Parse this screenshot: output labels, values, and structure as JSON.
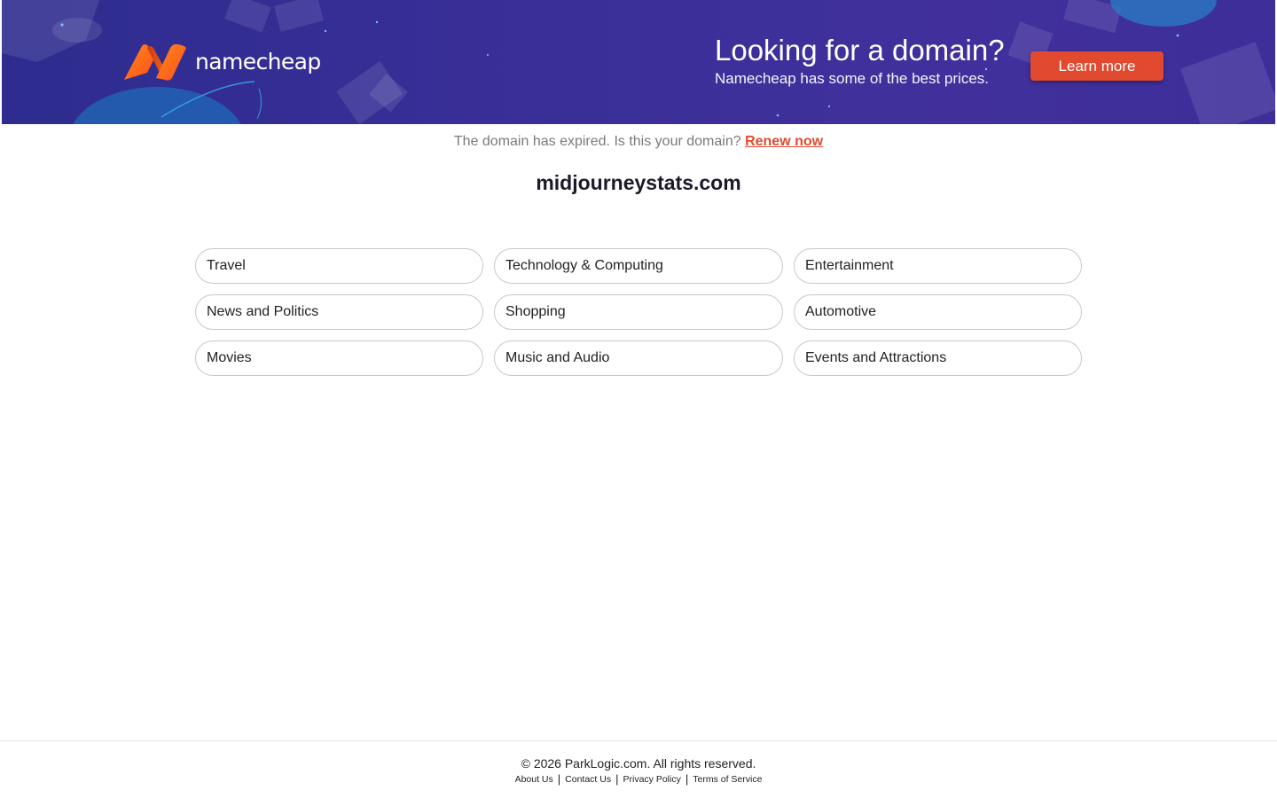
{
  "banner": {
    "logo_text": "namecheap",
    "headline": "Looking for a domain?",
    "subheadline": "Namecheap has some of the best prices.",
    "cta_label": "Learn more",
    "colors": {
      "background": "#3a2f98",
      "accent": "#e14a2f",
      "logo_orange": "#ff6b1a"
    }
  },
  "notice": {
    "text": "The domain has expired. Is this your domain?",
    "link_label": "Renew now"
  },
  "domain": {
    "name": "midjourneystats.com"
  },
  "categories": [
    {
      "label": "Travel"
    },
    {
      "label": "Technology & Computing"
    },
    {
      "label": "Entertainment"
    },
    {
      "label": "News and Politics"
    },
    {
      "label": "Shopping"
    },
    {
      "label": "Automotive"
    },
    {
      "label": "Movies"
    },
    {
      "label": "Music and Audio"
    },
    {
      "label": "Events and Attractions"
    }
  ],
  "footer": {
    "copyright": "© 2026 ParkLogic.com. All rights reserved.",
    "links": [
      {
        "label": "About Us"
      },
      {
        "label": "Contact Us"
      },
      {
        "label": "Privacy Policy"
      },
      {
        "label": "Terms of Service"
      }
    ],
    "separator": "|"
  }
}
